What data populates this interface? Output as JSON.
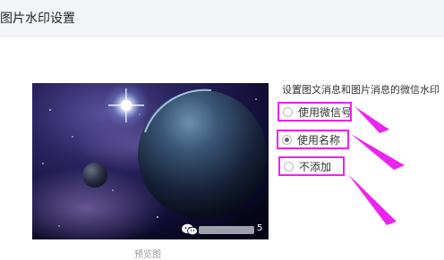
{
  "header": {
    "title": "图片水印设置"
  },
  "settings": {
    "prompt": "设置图文消息和图片消息的微信水印",
    "options": [
      {
        "label": "使用微信号",
        "selected": false
      },
      {
        "label": "使用名称",
        "selected": true
      },
      {
        "label": "不添加",
        "selected": false
      }
    ]
  },
  "preview": {
    "caption": "预览图",
    "watermark_icon": "wechat-logo-icon",
    "watermark_visible_suffix": "5"
  },
  "annotation": {
    "highlight_color": "#ee22ee"
  }
}
